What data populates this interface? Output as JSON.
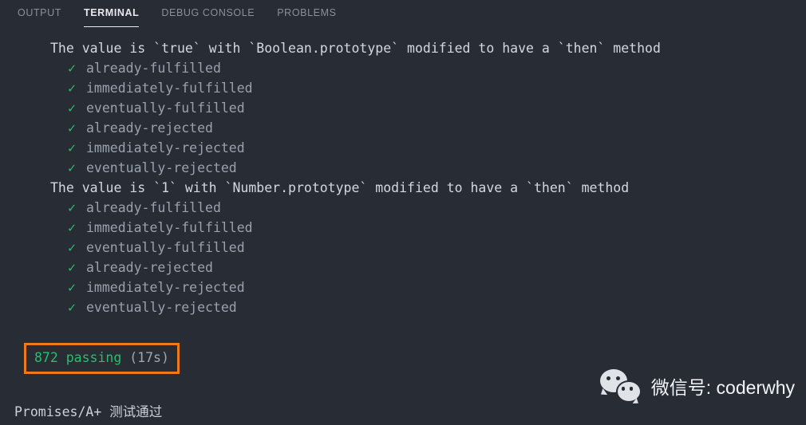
{
  "panel": {
    "tabs": [
      {
        "label": "OUTPUT",
        "active": false
      },
      {
        "label": "TERMINAL",
        "active": true
      },
      {
        "label": "DEBUG CONSOLE",
        "active": false
      },
      {
        "label": "PROBLEMS",
        "active": false
      }
    ]
  },
  "terminal": {
    "blocks": [
      {
        "header": "The value is `true` with `Boolean.prototype` modified to have a `then` method",
        "check": "✓",
        "tests": [
          "already-fulfilled",
          "immediately-fulfilled",
          "eventually-fulfilled",
          "already-rejected",
          "immediately-rejected",
          "eventually-rejected"
        ]
      },
      {
        "header": "The value is `1` with `Number.prototype` modified to have a `then` method",
        "check": "✓",
        "tests": [
          "already-fulfilled",
          "immediately-fulfilled",
          "eventually-fulfilled",
          "already-rejected",
          "immediately-rejected",
          "eventually-rejected"
        ]
      }
    ],
    "summary": {
      "count_text": "872 passing",
      "duration_text": "(17s)",
      "highlight_color": "#f0791a",
      "pass_color": "#2cbc6e"
    }
  },
  "caption": "Promises/A+ 测试通过",
  "watermark": {
    "icon": "wechat-icon",
    "text": "微信号: coderwhy"
  }
}
